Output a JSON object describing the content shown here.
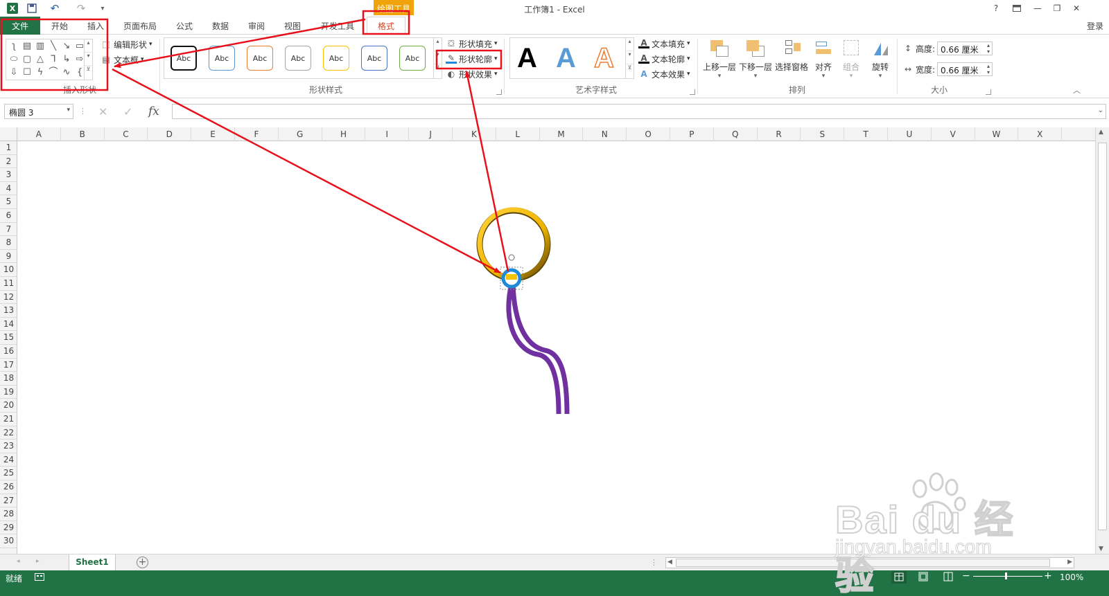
{
  "title_bar": {
    "title": "工作簿1 - Excel",
    "help": "?",
    "minimize": "—",
    "restore": "❐",
    "close": "✕",
    "undo_icon": "↶",
    "redo_icon": "↷"
  },
  "contextual_header": "绘图工具",
  "tabs": [
    {
      "label": "文件"
    },
    {
      "label": "开始"
    },
    {
      "label": "插入"
    },
    {
      "label": "页面布局"
    },
    {
      "label": "公式"
    },
    {
      "label": "数据"
    },
    {
      "label": "审阅"
    },
    {
      "label": "视图"
    },
    {
      "label": "开发工具"
    },
    {
      "label": "格式"
    }
  ],
  "signin": "登录",
  "ribbon": {
    "insert_shapes": {
      "label": "插入形状",
      "edit_shape": "编辑形状",
      "text_box": "文本框"
    },
    "shape_styles": {
      "label": "形状样式",
      "sample": "Abc",
      "fill": "形状填充",
      "outline": "形状轮廓",
      "effects": "形状效果"
    },
    "wordart": {
      "label": "艺术字样式",
      "letter": "A",
      "text_fill": "文本填充",
      "text_outline": "文本轮廓",
      "text_effects": "文本效果"
    },
    "arrange": {
      "label": "排列",
      "bring_forward": "上移一层",
      "send_backward": "下移一层",
      "selection_pane": "选择窗格",
      "align": "对齐",
      "group": "组合",
      "rotate": "旋转"
    },
    "size": {
      "label": "大小",
      "height_label": "高度:",
      "height_value": "0.66 厘米",
      "width_label": "宽度:",
      "width_value": "0.66 厘米"
    }
  },
  "formula_bar": {
    "name_box": "椭圆 3",
    "fx": "fx",
    "cancel": "✕",
    "enter": "✓",
    "value": ""
  },
  "columns": [
    "A",
    "B",
    "C",
    "D",
    "E",
    "F",
    "G",
    "H",
    "I",
    "J",
    "K",
    "L",
    "M",
    "N",
    "O",
    "P",
    "Q",
    "R",
    "S",
    "T",
    "U",
    "V",
    "W",
    "X"
  ],
  "rows": [
    "1",
    "2",
    "3",
    "4",
    "5",
    "6",
    "7",
    "8",
    "9",
    "10",
    "11",
    "12",
    "13",
    "14",
    "15",
    "16",
    "17",
    "18",
    "19",
    "20",
    "21",
    "22",
    "23",
    "24",
    "25",
    "26",
    "27",
    "28",
    "29",
    "30"
  ],
  "sheet_tab": "Sheet1",
  "status": {
    "ready": "就绪",
    "zoom": "100%",
    "zoom_minus": "−",
    "zoom_plus": "+"
  },
  "watermark": {
    "brand": "Bai du 经验",
    "url": "jingyan.baidu.com"
  },
  "colors": {
    "excel_green": "#217346",
    "context_orange": "#f0a30a",
    "annotation_red": "#e8111b",
    "ring_gold": "#f5c400",
    "purple_stroke": "#7030a0",
    "selected_blue": "#1f8ad8"
  }
}
